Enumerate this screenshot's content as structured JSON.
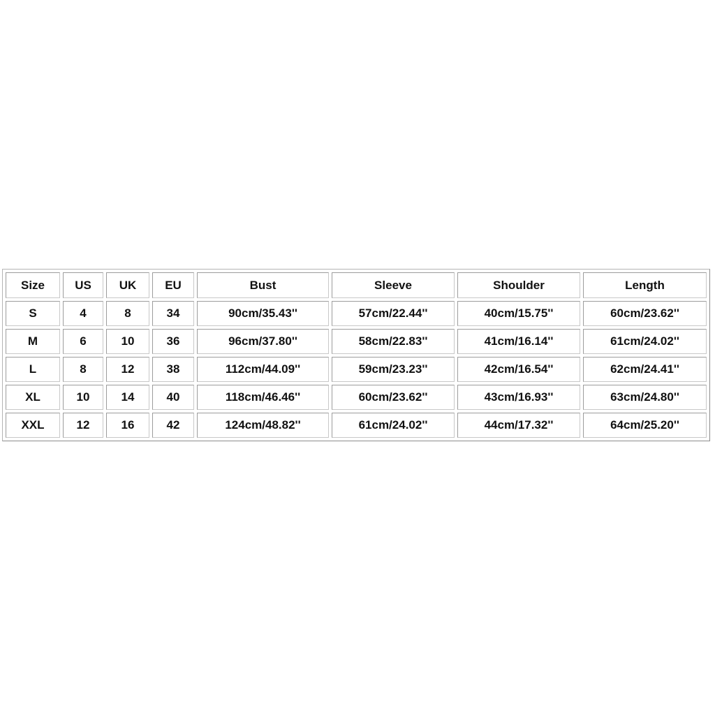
{
  "size_chart": {
    "headers": [
      "Size",
      "US",
      "UK",
      "EU",
      "Bust",
      "Sleeve",
      "Shoulder",
      "Length"
    ],
    "rows": [
      [
        "S",
        "4",
        "8",
        "34",
        "90cm/35.43''",
        "57cm/22.44''",
        "40cm/15.75''",
        "60cm/23.62''"
      ],
      [
        "M",
        "6",
        "10",
        "36",
        "96cm/37.80''",
        "58cm/22.83''",
        "41cm/16.14''",
        "61cm/24.02''"
      ],
      [
        "L",
        "8",
        "12",
        "38",
        "112cm/44.09''",
        "59cm/23.23''",
        "42cm/16.54''",
        "62cm/24.41''"
      ],
      [
        "XL",
        "10",
        "14",
        "40",
        "118cm/46.46''",
        "60cm/23.62''",
        "43cm/16.93''",
        "63cm/24.80''"
      ],
      [
        "XXL",
        "12",
        "16",
        "42",
        "124cm/48.82''",
        "61cm/24.02''",
        "44cm/17.32''",
        "64cm/25.20''"
      ]
    ]
  }
}
